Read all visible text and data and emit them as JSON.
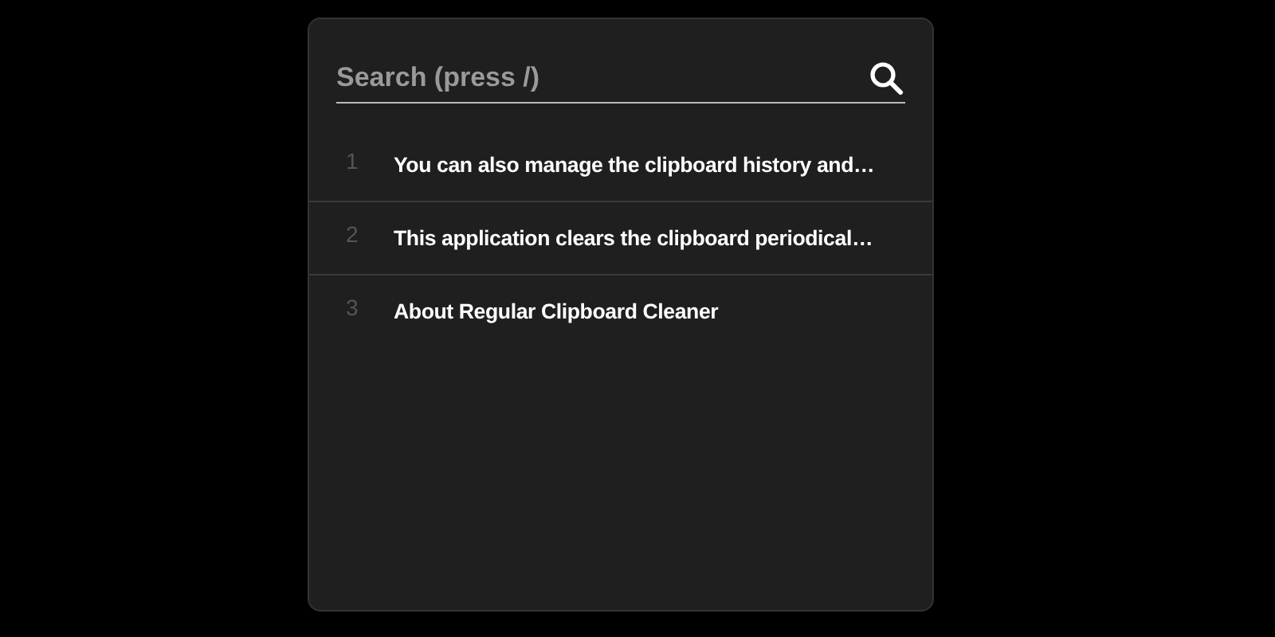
{
  "search": {
    "placeholder": "Search (press /)"
  },
  "results": [
    {
      "number": "1",
      "text": "You can also manage the clipboard history and…"
    },
    {
      "number": "2",
      "text": "This application clears the clipboard periodical…"
    },
    {
      "number": "3",
      "text": "About Regular Clipboard Cleaner"
    }
  ]
}
